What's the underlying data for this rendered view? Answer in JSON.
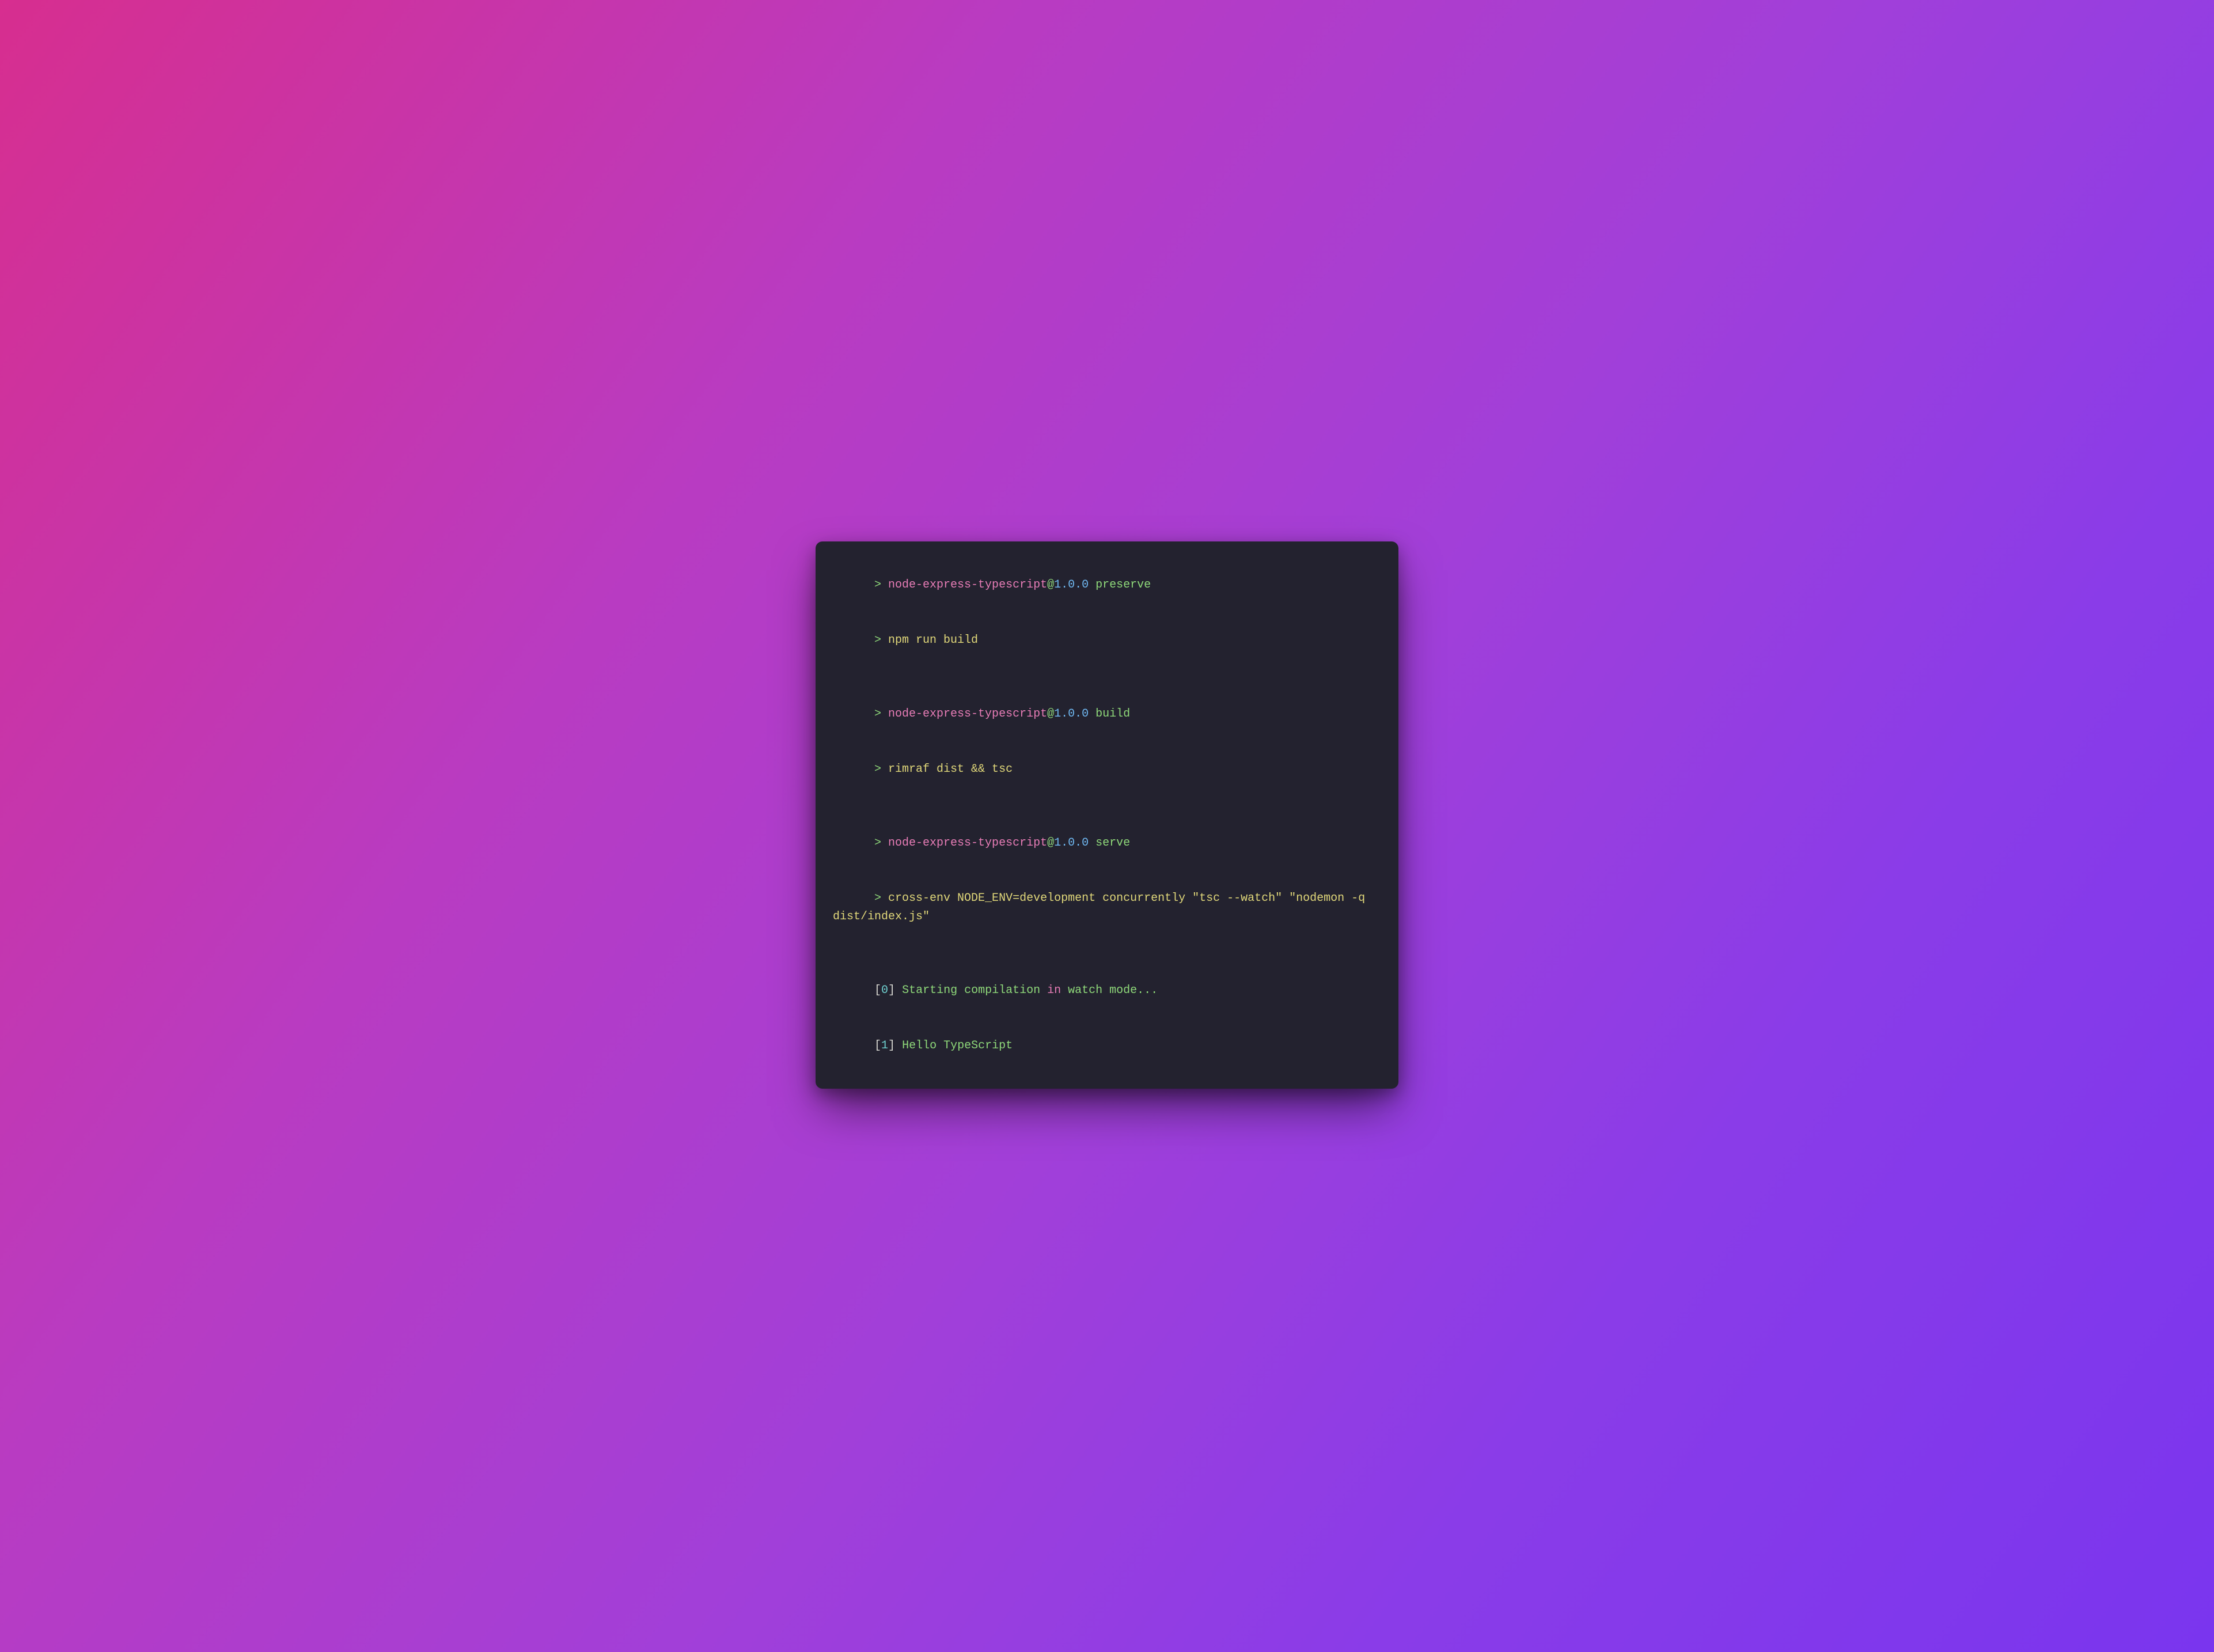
{
  "terminal": {
    "lines": [
      {
        "type": "script",
        "prompt": "> ",
        "pkg": "node-express-typescript",
        "at": "@",
        "ver": "1.0.0",
        "script": "preserve"
      },
      {
        "type": "cmd",
        "prompt": "> ",
        "cmd": "npm run build"
      },
      {
        "type": "blank"
      },
      {
        "type": "script",
        "prompt": "> ",
        "pkg": "node-express-typescript",
        "at": "@",
        "ver": "1.0.0",
        "script": "build"
      },
      {
        "type": "cmd",
        "prompt": "> ",
        "cmd": "rimraf dist && tsc"
      },
      {
        "type": "blank"
      },
      {
        "type": "script",
        "prompt": "> ",
        "pkg": "node-express-typescript",
        "at": "@",
        "ver": "1.0.0",
        "script": "serve"
      },
      {
        "type": "cmd",
        "prompt": "> ",
        "cmd": "cross-env NODE_ENV=development concurrently \"tsc --watch\" \"nodemon -q dist/index.js\""
      },
      {
        "type": "blank"
      },
      {
        "type": "proc",
        "lb": "[",
        "idx": "0",
        "rb": "] ",
        "seg1": "Starting compilation ",
        "kw": "in",
        "seg2": " watch mode..."
      },
      {
        "type": "proc",
        "lb": "[",
        "idx": "1",
        "rb": "] ",
        "seg1": "Hello TypeScript",
        "kw": "",
        "seg2": ""
      }
    ]
  }
}
